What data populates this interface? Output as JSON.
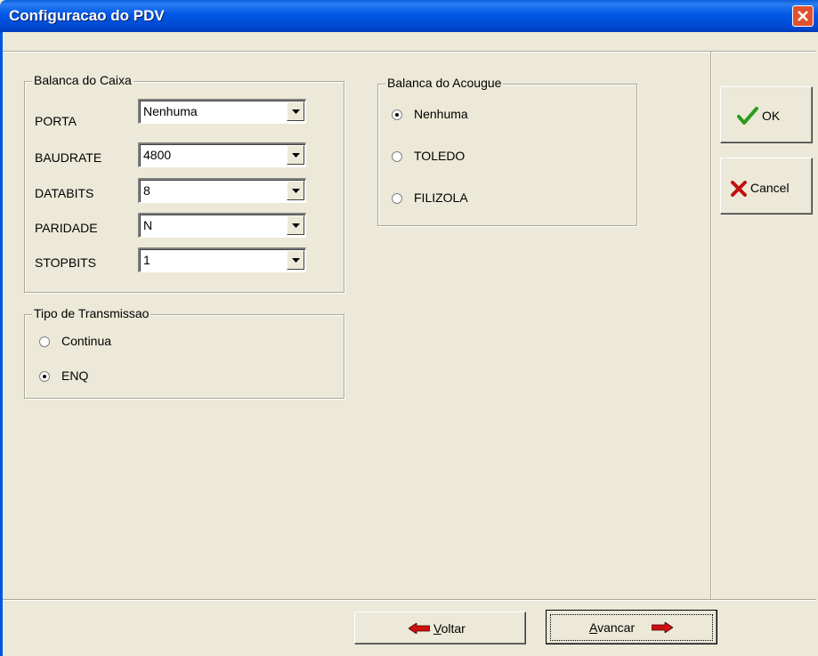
{
  "window": {
    "title": "Configuracao do PDV"
  },
  "balanca_caixa": {
    "legend": "Balanca do Caixa",
    "fields": [
      {
        "label": "PORTA",
        "value": "Nenhuma"
      },
      {
        "label": "BAUDRATE",
        "value": "4800"
      },
      {
        "label": "DATABITS",
        "value": "8"
      },
      {
        "label": "PARIDADE",
        "value": "N"
      },
      {
        "label": "STOPBITS",
        "value": "1"
      }
    ]
  },
  "tipo_transmissao": {
    "legend": "Tipo de Transmissao",
    "options": [
      {
        "label": "Continua",
        "selected": false
      },
      {
        "label": "ENQ",
        "selected": true
      }
    ]
  },
  "balanca_acougue": {
    "legend": "Balanca do Acougue",
    "options": [
      {
        "label": "Nenhuma",
        "selected": true
      },
      {
        "label": "TOLEDO",
        "selected": false
      },
      {
        "label": "FILIZOLA",
        "selected": false
      }
    ]
  },
  "buttons": {
    "ok": "OK",
    "cancel": "Cancel",
    "voltar_key": "V",
    "voltar_rest": "oltar",
    "avancar_key": "A",
    "avancar_rest": "vancar"
  },
  "colors": {
    "titlebar": "#0058e6",
    "close": "#e0512f",
    "ok_check": "#2e9a1e",
    "cancel_x": "#c01010",
    "arrow": "#d01010"
  }
}
